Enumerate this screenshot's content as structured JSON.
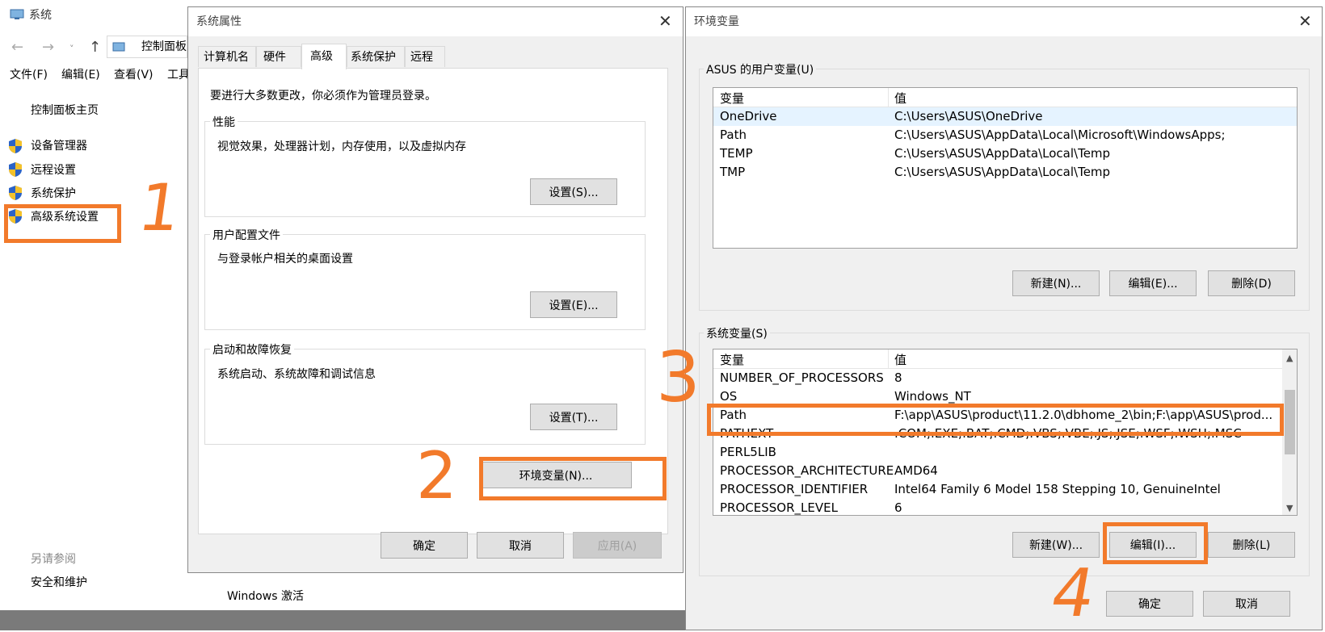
{
  "system_window": {
    "title": "系统",
    "address_text": "控制面板",
    "menu": [
      "文件(F)",
      "编辑(E)",
      "查看(V)",
      "工具"
    ],
    "home_link": "控制面板主页",
    "side_items": [
      "设备管理器",
      "远程设置",
      "系统保护",
      "高级系统设置"
    ],
    "see_also_label": "另请参阅",
    "see_also_item": "安全和维护",
    "activation_text": "Windows 激活"
  },
  "props_dialog": {
    "title": "系统属性",
    "tabs": [
      "计算机名",
      "硬件",
      "高级",
      "系统保护",
      "远程"
    ],
    "active_tab": "高级",
    "admin_note": "要进行大多数更改，你必须作为管理员登录。",
    "groups": [
      {
        "label": "性能",
        "desc": "视觉效果，处理器计划，内存使用，以及虚拟内存",
        "button": "设置(S)..."
      },
      {
        "label": "用户配置文件",
        "desc": "与登录帐户相关的桌面设置",
        "button": "设置(E)..."
      },
      {
        "label": "启动和故障恢复",
        "desc": "系统启动、系统故障和调试信息",
        "button": "设置(T)..."
      }
    ],
    "env_button": "环境变量(N)...",
    "ok": "确定",
    "cancel": "取消",
    "apply": "应用(A)"
  },
  "env_dialog": {
    "title": "环境变量",
    "user_section_label": "ASUS 的用户变量(U)",
    "col_var": "变量",
    "col_val": "值",
    "user_vars": [
      {
        "name": "OneDrive",
        "value": "C:\\Users\\ASUS\\OneDrive"
      },
      {
        "name": "Path",
        "value": "C:\\Users\\ASUS\\AppData\\Local\\Microsoft\\WindowsApps;"
      },
      {
        "name": "TEMP",
        "value": "C:\\Users\\ASUS\\AppData\\Local\\Temp"
      },
      {
        "name": "TMP",
        "value": "C:\\Users\\ASUS\\AppData\\Local\\Temp"
      }
    ],
    "user_buttons": [
      "新建(N)...",
      "编辑(E)...",
      "删除(D)"
    ],
    "system_section_label": "系统变量(S)",
    "system_vars": [
      {
        "name": "NUMBER_OF_PROCESSORS",
        "value": "8"
      },
      {
        "name": "OS",
        "value": "Windows_NT"
      },
      {
        "name": "Path",
        "value": "F:\\app\\ASUS\\product\\11.2.0\\dbhome_2\\bin;F:\\app\\ASUS\\prod..."
      },
      {
        "name": "PATHEXT",
        "value": ".COM;.EXE;.BAT;.CMD;.VBS;.VBE;.JS;.JSE;.WSF;.WSH;.MSC"
      },
      {
        "name": "PERL5LIB",
        "value": ""
      },
      {
        "name": "PROCESSOR_ARCHITECTURE",
        "value": "AMD64"
      },
      {
        "name": "PROCESSOR_IDENTIFIER",
        "value": "Intel64 Family 6 Model 158 Stepping 10, GenuineIntel"
      },
      {
        "name": "PROCESSOR_LEVEL",
        "value": "6"
      }
    ],
    "system_buttons": [
      "新建(W)...",
      "编辑(I)...",
      "删除(L)"
    ],
    "ok": "确定",
    "cancel": "取消"
  },
  "annotations": [
    "1",
    "2",
    "3",
    "4"
  ],
  "colors": {
    "highlight": "#f27a2b",
    "selected_row": "#e5f3ff",
    "button": "#e1e1e1"
  }
}
